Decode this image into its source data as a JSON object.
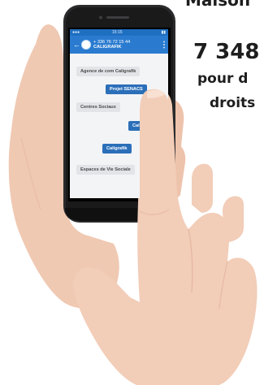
{
  "page": {
    "heading_fragment": "Maison",
    "stat_number": "7 348",
    "stat_line_1": "pour d",
    "stat_line_2": "droits"
  },
  "phone": {
    "status_bar": {
      "left_icons": "●●●",
      "time": "15:15",
      "battery": "▮▮"
    },
    "header": {
      "contact_number": "+ 336 76 72 15 44",
      "contact_name": "CALIGRAFIK",
      "back_icon": "arrow-left-icon",
      "menu_icon": "more-vertical-icon"
    },
    "messages": [
      {
        "text": "Agence de com Caligrafik",
        "direction": "incoming"
      },
      {
        "text": "Projet SENACS",
        "direction": "outgoing"
      },
      {
        "text": "Centres Sociaux",
        "direction": "incoming"
      },
      {
        "text": "Caligr",
        "direction": "outgoing"
      },
      {
        "text": "Caligrafik",
        "direction": "outgoing"
      },
      {
        "text": "Espaces de Vie Sociale",
        "direction": "incoming"
      }
    ]
  },
  "colors": {
    "header_blue": "#2a7bd0",
    "outgoing_bubble": "#2b6fb9",
    "incoming_bubble": "#e2e4e8",
    "skin": "#f2cdb8"
  }
}
